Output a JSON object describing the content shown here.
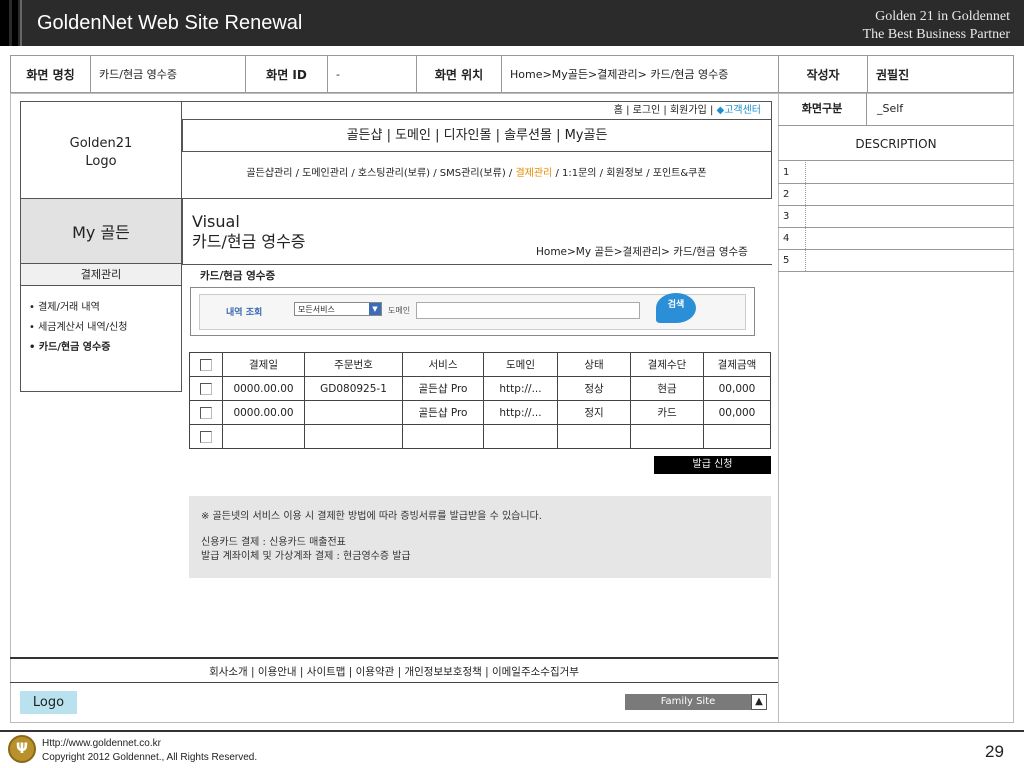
{
  "header": {
    "title": "GoldenNet Web Site Renewal",
    "sub1": "Golden 21 in Goldennet",
    "sub2": "The Best Business Partner"
  },
  "meta": {
    "screen_name_label": "화면 명칭",
    "screen_name": "카드/현금 영수증",
    "screen_id_label": "화면 ID",
    "screen_id": "-",
    "location_label": "화면 위치",
    "location": "Home>My골든>결제관리> 카드/현금 영수증",
    "author_label": "작성자",
    "author": "권필진"
  },
  "left": {
    "logo_line1": "Golden21",
    "logo_line2": "Logo",
    "my": "My 골든",
    "section": "결제관리",
    "menu": [
      "• 결제/거래 내역",
      "• 세금계산서 내역/신청",
      "• 카드/현금 영수증"
    ]
  },
  "topnav": {
    "links": "홈 | 로그인 | 회원가입 | ",
    "cs": "◆고객센터"
  },
  "nav1": "골든샵 | 도메인 | 디자인몰 | 솔루션몰 | My골든",
  "nav2": {
    "pre": "골든샵관리 / 도메인관리 / 호스팅관리(보류) / SMS관리(보류) / ",
    "hl": "결제관리",
    "post": " / 1:1문의 / 회원정보 / 포인트&쿠폰"
  },
  "visual": {
    "line1": "Visual",
    "line2": "카드/현금 영수증"
  },
  "crumb": "Home>My 골든>결제관리> 카드/현금 영수증",
  "section_title": "카드/현금 영수증",
  "search": {
    "label": "내역 조회",
    "select": "모든서비스",
    "domain_label": "도메인",
    "button": "검색"
  },
  "table": {
    "headers": [
      "결제일",
      "주문번호",
      "서비스",
      "도메인",
      "상태",
      "결제수단",
      "결제금액"
    ],
    "rows": [
      [
        "0000.00.00",
        "GD080925-1",
        "골든샵 Pro",
        "http://...",
        "정상",
        "현금",
        "00,000"
      ],
      [
        "0000.00.00",
        "",
        "골든샵 Pro",
        "http://...",
        "정지",
        "카드",
        "00,000"
      ],
      [
        "",
        "",
        "",
        "",
        "",
        "",
        ""
      ]
    ]
  },
  "issue_button": "발급 신청",
  "notice": {
    "line1": "※ 골든넷의 서비스 이용 시 결제한 방법에 따라 증빙서류를 발급받을 수 있습니다.",
    "line2": "신용카드 결제 : 신용카드 매출전표",
    "line3": "발급 계좌이체 및 가상계좌 결제 : 현금영수증 발급"
  },
  "right": {
    "type_label": "화면구분",
    "type_value": "_Self",
    "desc": "DESCRIPTION",
    "items": [
      "1",
      "2",
      "3",
      "4",
      "5"
    ]
  },
  "footer": {
    "links": "회사소개 | 이용안내 | 사이트맵 | 이용약관 | 개인정보보호정책 | 이메일주소수집거부",
    "logo": "Logo",
    "family": "Family Site",
    "family_arrow": "▲"
  },
  "bottom": {
    "url": "Http://www.goldennet.co.kr",
    "copyright": "Copyright 2012 Goldennet., All Rights Reserved.",
    "page": "29"
  }
}
